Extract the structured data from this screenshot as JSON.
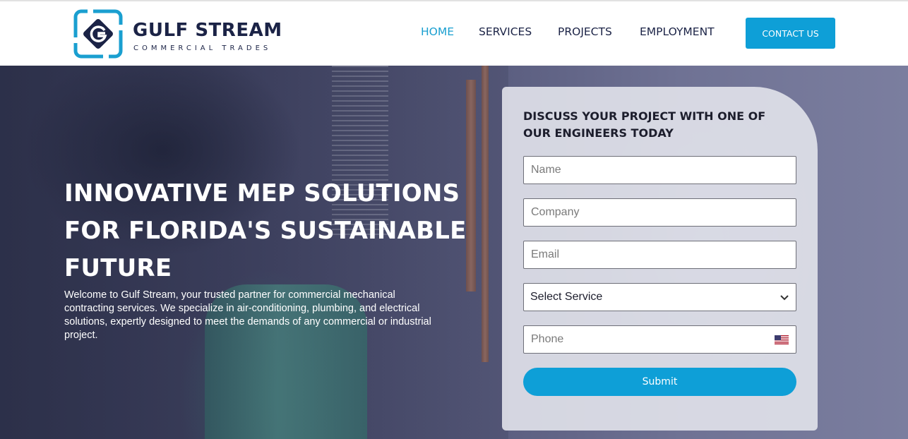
{
  "brand": {
    "name": "GULF STREAM",
    "tagline": "COMMERCIAL TRADES",
    "logo_icon": "g-monogram-icon",
    "primary_color": "#0e9fd7",
    "navy_color": "#1b2346"
  },
  "nav": {
    "items": [
      {
        "label": "HOME",
        "active": true
      },
      {
        "label": "SERVICES",
        "active": false
      },
      {
        "label": "PROJECTS",
        "active": false
      },
      {
        "label": "EMPLOYMENT",
        "active": false
      }
    ],
    "cta_label": "CONTACT US"
  },
  "hero": {
    "title_lines": [
      "INNOVATIVE MEP SOLUTIONS",
      "FOR FLORIDA'S SUSTAINABLE",
      "FUTURE"
    ],
    "description": "Welcome to Gulf Stream, your trusted partner for commercial mechanical contracting services. We specialize in air-conditioning, plumbing, and electrical solutions, expertly designed to meet the demands of any commercial or industrial project."
  },
  "form": {
    "heading": "DISCUSS YOUR PROJECT WITH ONE OF OUR ENGINEERS TODAY",
    "name_placeholder": "Name",
    "company_placeholder": "Company",
    "email_placeholder": "Email",
    "service_selected": "Select Service",
    "phone_placeholder": "Phone",
    "phone_country_icon": "us-flag-icon",
    "submit_label": "Submit"
  }
}
